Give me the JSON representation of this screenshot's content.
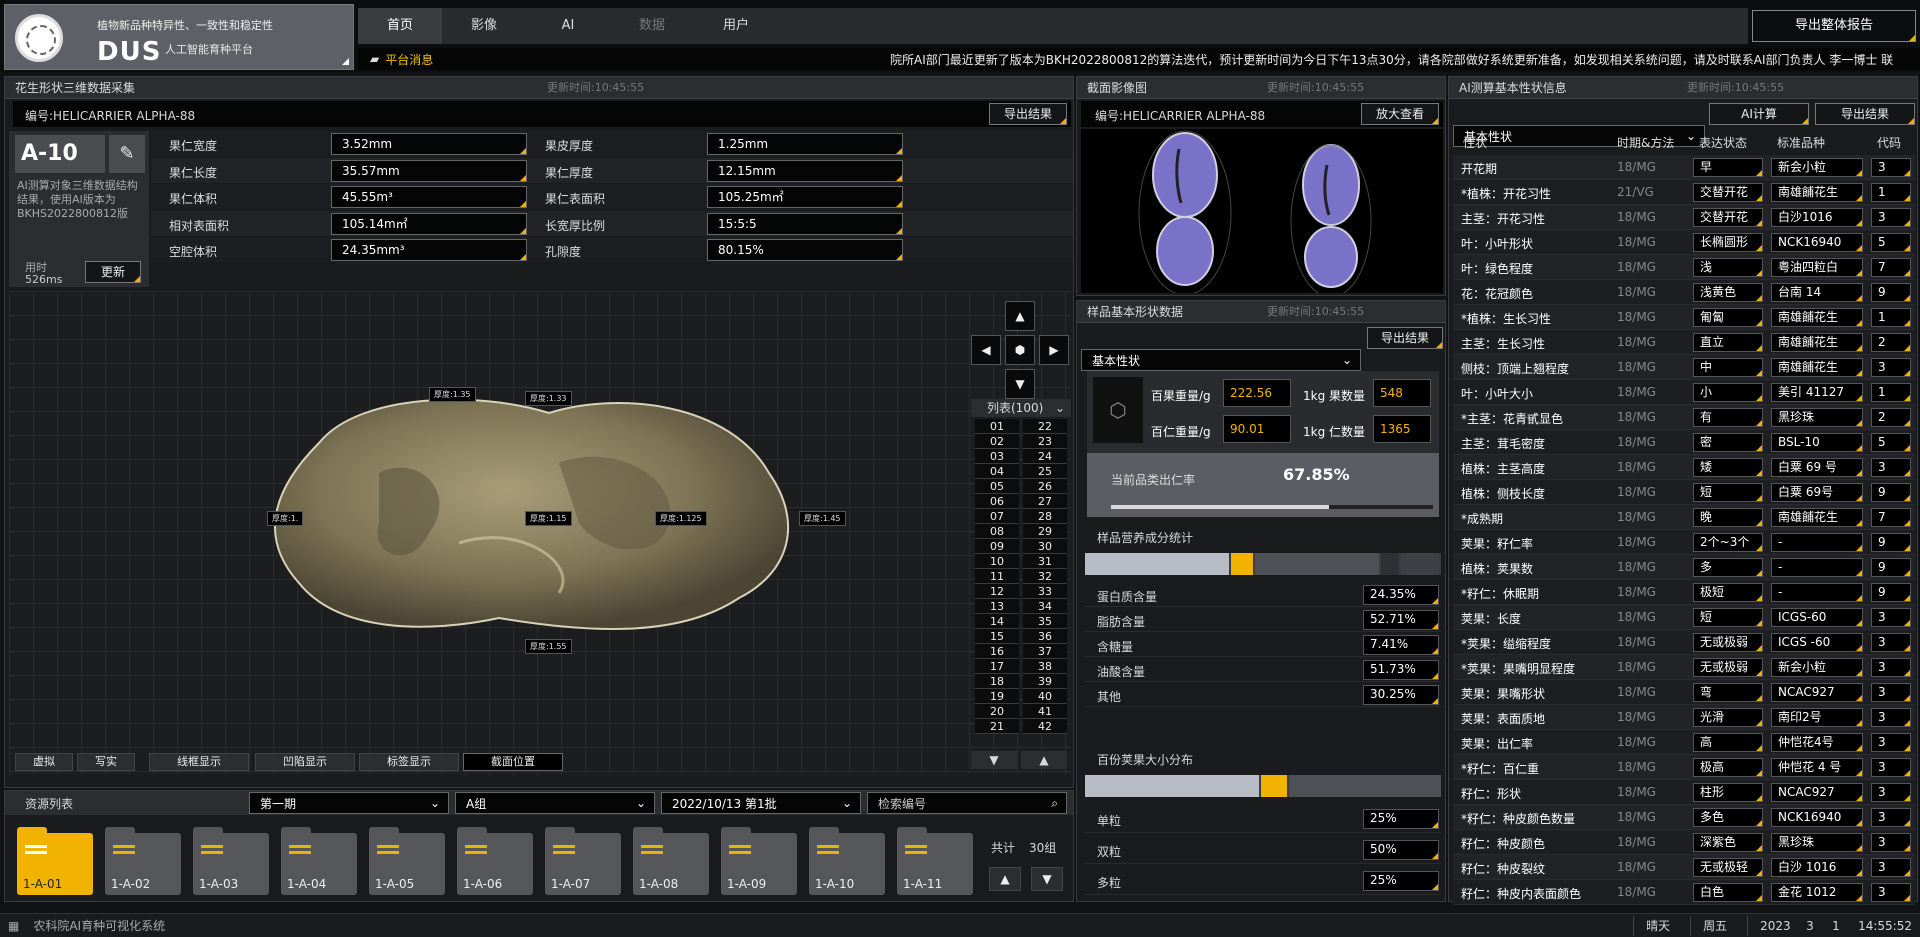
{
  "header": {
    "logo_line1": "植物新品种特异性、一致性和稳定性",
    "logo_big": "DUS",
    "logo_line2": "人工智能育种平台",
    "nav": [
      "首页",
      "影像",
      "AI",
      "数据",
      "用户"
    ],
    "export_all": "导出整体报告",
    "notice_label": "平台消息",
    "notice_text": "院所AI部门最近更新了版本为BKH2022800812的算法迭代，预计更新时间为今日下午13点30分，请各院部做好系统更新准备，如发现相关系统问题，请及时联系AI部门负责人 李一博士 联"
  },
  "left": {
    "title": "花生形状三维数据采集",
    "time": "更新时间:10:45:55",
    "code": "编号:HELICARRIER ALPHA-88",
    "export": "导出结果",
    "sample_id": "A-10",
    "desc": "AI测算对象三维数据结构结果，使用AI版本为BKHS2022800812版",
    "elapsed_label": "用时",
    "elapsed_value": "526ms",
    "update": "更新",
    "metrics": [
      {
        "l": "果仁宽度",
        "v": "3.52mm",
        "l2": "果皮厚度",
        "v2": "1.25mm"
      },
      {
        "l": "果仁长度",
        "v": "35.57mm",
        "l2": "果仁厚度",
        "v2": "12.15mm"
      },
      {
        "l": "果仁体积",
        "v": "45.55m³",
        "l2": "果仁表面积",
        "v2": "105.25m㎡"
      },
      {
        "l": "相对表面积",
        "v": "105.14m㎡",
        "l2": "长宽厚比例",
        "v2": "15:5:5"
      },
      {
        "l": "空腔体积",
        "v": "24.35mm³",
        "l2": "孔隙度",
        "v2": "80.15%"
      }
    ],
    "tags": [
      "厚度:1.35",
      "厚度:1.33",
      "厚度:1.",
      "厚度:1.15",
      "厚度:1.125",
      "厚度:1.45",
      "厚度:1.55"
    ],
    "list_title": "列表(100)",
    "list_left": [
      "01",
      "02",
      "03",
      "04",
      "05",
      "06",
      "07",
      "08",
      "09",
      "10",
      "11",
      "12",
      "13",
      "14",
      "15",
      "16",
      "17",
      "18",
      "19",
      "20",
      "21"
    ],
    "list_right": [
      "22",
      "23",
      "24",
      "25",
      "26",
      "27",
      "28",
      "29",
      "30",
      "31",
      "32",
      "33",
      "34",
      "35",
      "36",
      "37",
      "38",
      "39",
      "40",
      "41",
      "42"
    ],
    "view_buttons": [
      "虚拟",
      "写实",
      "线框显示",
      "凹陷显示",
      "标签显示",
      "截面位置"
    ]
  },
  "resources": {
    "title": "资源列表",
    "period": "第一期",
    "group": "A组",
    "batch": "2022/10/13 第1批",
    "search_placeholder": "检索编号",
    "folders": [
      "1-A-01",
      "1-A-02",
      "1-A-03",
      "1-A-04",
      "1-A-05",
      "1-A-06",
      "1-A-07",
      "1-A-08",
      "1-A-09",
      "1-A-10",
      "1-A-11"
    ],
    "total_label": "共计",
    "total_value": "30组"
  },
  "section": {
    "title": "截面影像图",
    "time": "更新时间:10:45:55",
    "code": "编号:HELICARRIER ALPHA-88",
    "zoom": "放大查看"
  },
  "shape": {
    "title": "样品基本形状数据",
    "time": "更新时间:10:45:55",
    "select": "基本性状",
    "export": "导出结果",
    "kpis": [
      {
        "l": "百果重量/g",
        "v": "222.56",
        "l2": "1kg 果数量",
        "v2": "548"
      },
      {
        "l": "百仁重量/g",
        "v": "90.01",
        "l2": "1kg 仁数量",
        "v2": "1365"
      }
    ],
    "rate_label": "当前品类出仁率",
    "rate_value": "67.85%",
    "rate_fraction": 0.6785,
    "nutrition_title": "样品营养成分统计",
    "nutrients": [
      {
        "l": "蛋白质含量",
        "v": "24.35%"
      },
      {
        "l": "脂肪含量",
        "v": "52.71%"
      },
      {
        "l": "含糖量",
        "v": "7.41%"
      },
      {
        "l": "油酸含量",
        "v": "51.73%"
      },
      {
        "l": "其他",
        "v": "30.25%"
      }
    ],
    "size_title": "百份荚果大小分布",
    "sizes": [
      {
        "l": "单粒",
        "v": "25%"
      },
      {
        "l": "双粒",
        "v": "50%"
      },
      {
        "l": "多粒",
        "v": "25%"
      }
    ]
  },
  "ai": {
    "title": "AI测算基本性状信息",
    "time": "更新时间:10:45:55",
    "select": "基本性状",
    "calc": "AI计算",
    "export": "导出结果",
    "headers": [
      "性状",
      "时期&方法",
      "表达状态",
      "标准品种",
      "代码"
    ],
    "rows": [
      [
        "开花期",
        "18/MG",
        "早",
        "新会小粒",
        "3"
      ],
      [
        "*植株：开花习性",
        "21/VG",
        "交替开花",
        "南雄餔花生",
        "1"
      ],
      [
        "主茎：开花习性",
        "18/MG",
        "交替开花",
        "白沙1016",
        "3"
      ],
      [
        "叶：小叶形状",
        "18/MG",
        "长椭圆形",
        "NCK16940",
        "5"
      ],
      [
        "叶：绿色程度",
        "18/MG",
        "浅",
        "粤油四粒白",
        "7"
      ],
      [
        "花：花冠颜色",
        "18/MG",
        "浅黄色",
        "台南 14",
        "9"
      ],
      [
        "*植株：生长习性",
        "18/MG",
        "匍匐",
        "南雄餔花生",
        "1"
      ],
      [
        "主茎：生长习性",
        "18/MG",
        "直立",
        "南雄餔花生",
        "2"
      ],
      [
        "侧枝：顶端上翘程度",
        "18/MG",
        "中",
        "南雄餔花生",
        "3"
      ],
      [
        "叶：小叶大小",
        "18/MG",
        "小",
        "美引 41127",
        "1"
      ],
      [
        "*主茎：花青甙显色",
        "18/MG",
        "有",
        "黑珍珠",
        "2"
      ],
      [
        "主茎：茸毛密度",
        "18/MG",
        "密",
        "BSL-10",
        "5"
      ],
      [
        "植株：主茎高度",
        "18/MG",
        "矮",
        "白粟 69 号",
        "3"
      ],
      [
        "植株：侧枝长度",
        "18/MG",
        "短",
        "白粟 69号",
        "9"
      ],
      [
        "*成熟期",
        "18/MG",
        "晚",
        "南雄餔花生",
        "7"
      ],
      [
        "荚果：籽仁率",
        "18/MG",
        "2个~3个",
        "-",
        "9"
      ],
      [
        "植株：荚果数",
        "18/MG",
        "多",
        "-",
        "9"
      ],
      [
        "*籽仁：休眠期",
        "18/MG",
        "极短",
        "-",
        "9"
      ],
      [
        "荚果：长度",
        "18/MG",
        "短",
        "ICGS-60",
        "3"
      ],
      [
        "*荚果：缢缩程度",
        "18/MG",
        "无或极弱",
        "ICGS -60",
        "3"
      ],
      [
        "*荚果：果嘴明显程度",
        "18/MG",
        "无或极弱",
        "新会小粒",
        "3"
      ],
      [
        "荚果：果嘴形状",
        "18/MG",
        "弯",
        "NCAC927",
        "3"
      ],
      [
        "荚果：表面质地",
        "18/MG",
        "光滑",
        "南印2号",
        "3"
      ],
      [
        "荚果：出仁率",
        "18/MG",
        "高",
        "仲恺花4号",
        "3"
      ],
      [
        "*籽仁：百仁重",
        "18/MG",
        "极高",
        "仲恺花 4 号",
        "3"
      ],
      [
        "籽仁：形状",
        "18/MG",
        "柱形",
        "NCAC927",
        "3"
      ],
      [
        "*籽仁：种皮颜色数量",
        "18/MG",
        "多色",
        "NCK16940",
        "3"
      ],
      [
        "籽仁：种皮颜色",
        "18/MG",
        "深紫色",
        "黑珍珠",
        "3"
      ],
      [
        "籽仁：种皮裂纹",
        "18/MG",
        "无或极轻",
        "白沙 1016",
        "3"
      ],
      [
        "籽仁：种皮内表面颜色",
        "18/MG",
        "白色",
        "金花 1012",
        "3"
      ]
    ]
  },
  "status": {
    "app_name": "农科院AI育种可视化系统",
    "weather": "晴天",
    "weekday": "周五",
    "year": "2023",
    "month": "3",
    "day": "1",
    "clock": "14:55:52"
  }
}
